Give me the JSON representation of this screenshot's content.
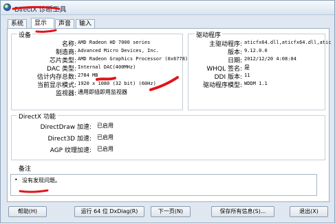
{
  "window": {
    "title": "DirectX 诊断工具"
  },
  "tabs": [
    {
      "label": "系统",
      "active": false
    },
    {
      "label": "显示",
      "active": true
    },
    {
      "label": "声音",
      "active": false
    },
    {
      "label": "输入",
      "active": false
    }
  ],
  "device": {
    "heading": "设备",
    "rows": [
      {
        "label": "名称:",
        "value": "AMD Radeon HD 7000 series"
      },
      {
        "label": "制造商:",
        "value": "Advanced Micro Devices, Inc."
      },
      {
        "label": "芯片类型:",
        "value": "AMD Radeon Graphics Processor (0x6778)"
      },
      {
        "label": "DAC 类型:",
        "value": "Internal DAC(400MHz)"
      },
      {
        "label": "估计内存总数:",
        "value": "2784 MB"
      },
      {
        "label": "当前显示模式:",
        "value": "1920 x 1080 (32 bit) (60Hz)"
      },
      {
        "label": "监视器:",
        "value": "通用即插即用监视器"
      }
    ]
  },
  "driver": {
    "heading": "驱动程序",
    "rows": [
      {
        "label": "主驱动程序:",
        "value": "aticfx64.dll,aticfx64.dll,atic"
      },
      {
        "label": "版本:",
        "value": "9.12.0.0"
      },
      {
        "label": "日期:",
        "value": "2012/12/20 4:08:04"
      },
      {
        "label": "WHQL 签名:",
        "value": "是"
      },
      {
        "label": "DDI 版本:",
        "value": "11"
      },
      {
        "label": "驱动程序模型:",
        "value": "WDDM 1.1"
      }
    ]
  },
  "directx": {
    "heading": "DirectX 功能",
    "rows": [
      {
        "label": "DirectDraw 加速:",
        "value": "已启用"
      },
      {
        "label": "Direct3D 加速:",
        "value": "已启用"
      },
      {
        "label": "AGP 纹理加速:",
        "value": "已启用"
      }
    ]
  },
  "notes": {
    "heading": "备注",
    "items": [
      "没有发现问题。"
    ]
  },
  "buttons": {
    "help": "帮助(H)",
    "run64": "运行 64 位 DxDiag(R)",
    "next": "下一页(N)",
    "save": "保存所有信息(S)...",
    "exit": "退出(X)"
  },
  "colors": {
    "annotation_red": "#e0141a",
    "window_bg": "#dfe7f0"
  }
}
